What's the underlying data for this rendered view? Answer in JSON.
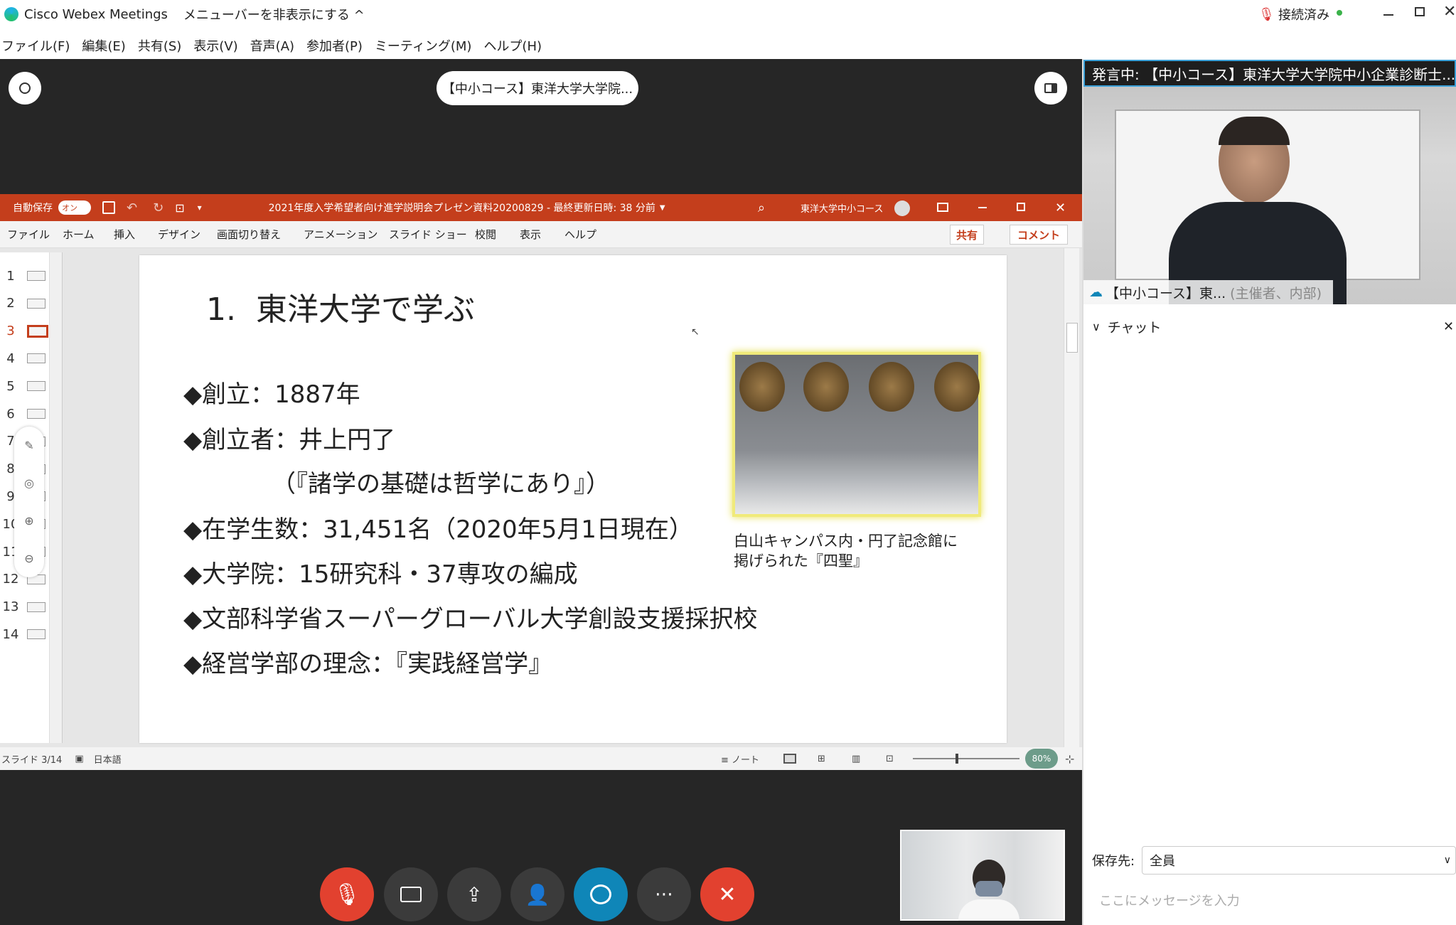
{
  "app": {
    "title": "Cisco Webex Meetings",
    "hide_menu": "メニューバーを非表示にする ^",
    "status": "接続済み"
  },
  "menu": [
    "ファイル(F)",
    "編集(E)",
    "共有(S)",
    "表示(V)",
    "音声(A)",
    "参加者(P)",
    "ミーティング(M)",
    "ヘルプ(H)"
  ],
  "meeting_pill": "【中小コース】東洋大学大学院...",
  "ppt": {
    "autosave": "自動保存",
    "autosave_state": "オン",
    "doc_title": "2021年度入学希望者向け進学説明会プレゼン資料20200829 - 最終更新日時: 38 分前",
    "user": "東洋大学中小コース",
    "tabs": [
      "ファイル",
      "ホーム",
      "挿入",
      "デザイン",
      "画面切り替え",
      "アニメーション",
      "スライド ショー",
      "校閲",
      "表示",
      "ヘルプ"
    ],
    "share": "共有",
    "comment": "コメント",
    "thumb_numbers": [
      "1",
      "2",
      "3",
      "4",
      "5",
      "6",
      "7",
      "8",
      "9",
      "10",
      "11",
      "12",
      "13",
      "14"
    ],
    "status_slide": "スライド 3/14",
    "status_lang": "日本語",
    "status_notes": "ノート",
    "zoom": "80%"
  },
  "slide": {
    "title": "1.  東洋大学で学ぶ",
    "bullets": [
      "◆創立：1887年",
      "◆創立者：井上円了",
      "（『諸学の基礎は哲学にあり』）",
      "◆在学生数：31,451名（2020年5月1日現在）",
      "◆大学院：15研究科・37専攻の編成",
      "◆文部科学省スーパーグローバル大学創設支援採択校",
      "◆経営学部の理念：『実践経営学』"
    ],
    "caption_line1": "白山キャンパス内・円了記念館に",
    "caption_line2": "掲げられた『四聖』"
  },
  "video": {
    "speaking": "発言中: 【中小コース】東洋大学大学院中小企業診断士...",
    "name_tag": "【中小コース】東...",
    "name_role": "(主催者、内部)"
  },
  "chat": {
    "header": "チャット",
    "to_label": "保存先:",
    "to_value": "全員",
    "placeholder": "ここにメッセージを入力"
  },
  "colors": {
    "ppt_red": "#c43e1c",
    "stage": "#262626",
    "mute_red": "#e2412f",
    "chat_blue": "#0f86b8"
  }
}
